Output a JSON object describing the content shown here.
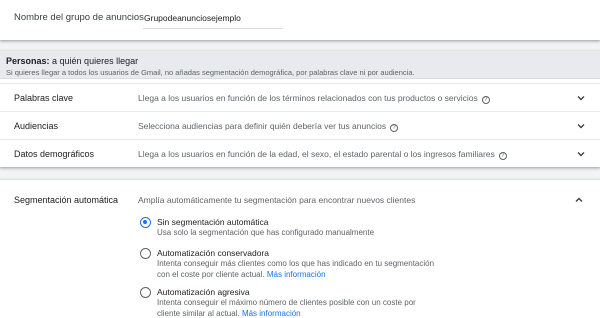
{
  "ad_group": {
    "label": "Nombre del grupo de anuncios",
    "value": "Grupodeanunciosejemplo"
  },
  "personas": {
    "title_bold": "Personas:",
    "title_rest": " a quién quieres llegar",
    "subtitle": "Si quieres llegar a todos los usuarios de Gmail, no añadas segmentación demográfica, por palabras clave ni por audiencia.",
    "rows": [
      {
        "title": "Palabras clave",
        "desc": "Llega a los usuarios en función de los términos relacionados con tus productos o servicios"
      },
      {
        "title": "Audiencias",
        "desc": "Selecciona audiencias para definir quién debería ver tus anuncios"
      },
      {
        "title": "Datos demográficos",
        "desc": "Llega a los usuarios en función de la edad, el sexo, el estado parental o los ingresos familiares"
      }
    ]
  },
  "segmentation": {
    "title": "Segmentación automática",
    "desc": "Amplía automáticamente tu segmentación para encontrar nuevos clientes",
    "options": [
      {
        "title": "Sin segmentación automática",
        "desc": "Usa solo la segmentación que has configurado manualmente",
        "link": "",
        "selected": true
      },
      {
        "title": "Automatización conservadora",
        "desc": "Intenta conseguir más clientes como los que has indicado en tu segmentación con el coste por cliente actual.",
        "link": "Más información",
        "selected": false
      },
      {
        "title": "Automatización agresiva",
        "desc": "Intenta conseguir el máximo número de clientes posible con un coste por cliente similar al actual.",
        "link": "Más información",
        "selected": false
      }
    ]
  },
  "icons": {
    "help": "help-circle-icon",
    "expand": "chevron-down-icon",
    "collapse": "chevron-up-icon"
  },
  "colors": {
    "accent": "#1a73e8",
    "header_bg": "#e8eaed",
    "page_bg": "#f1f3f4"
  }
}
